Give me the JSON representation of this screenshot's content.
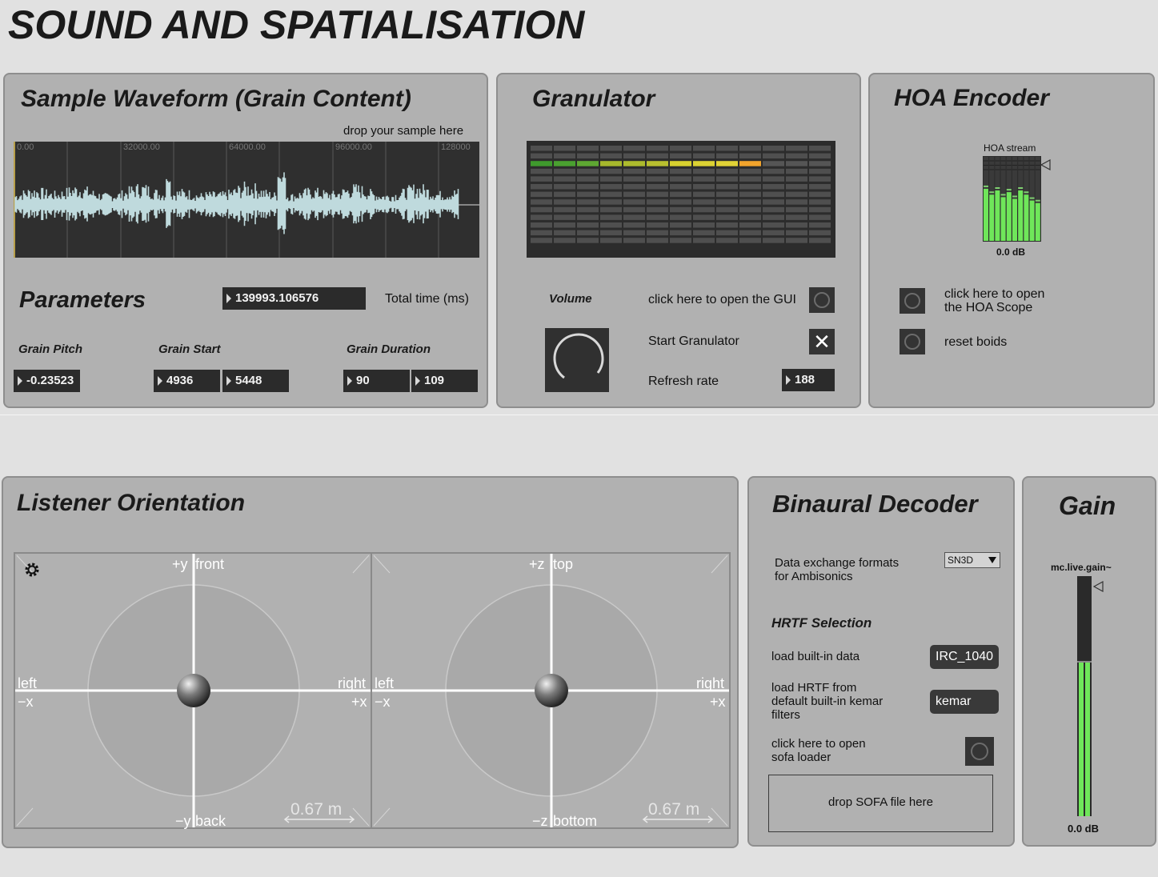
{
  "page_title": "SOUND AND SPATIALISATION",
  "waveform_panel": {
    "title": "Sample Waveform (Grain Content)",
    "drop_hint": "drop your sample here",
    "ruler": [
      "0.00",
      "32000.00",
      "64000.00",
      "96000.00",
      "128000"
    ],
    "wave_color": "#bfdadd",
    "parameters_title": "Parameters",
    "total_time_value": "139993.106576",
    "total_time_label": "Total time (ms)",
    "grain_pitch_label": "Grain Pitch",
    "grain_pitch_value": "-0.23523",
    "grain_start_label": "Grain Start",
    "grain_start_values": [
      "4936",
      "5448"
    ],
    "grain_duration_label": "Grain Duration",
    "grain_duration_values": [
      "90",
      "109"
    ]
  },
  "granulator": {
    "title": "Granulator",
    "meter_colors": [
      "#3f9a2d",
      "#4aa130",
      "#5ea832",
      "#a7b82c",
      "#adbb2d",
      "#b8bf2f",
      "#d8d12f",
      "#dcd233",
      "#e0d236",
      "#f2a42c",
      "#555555",
      "#555555",
      "#555555"
    ],
    "volume_label": "Volume",
    "volume_icon": "dial-icon",
    "open_gui_label": "click here to open the GUI",
    "start_label": "Start Granulator",
    "start_checked": "✕",
    "refresh_label": "Refresh rate",
    "refresh_value": "188"
  },
  "hoa": {
    "title": "HOA Encoder",
    "stream_label": "HOA stream",
    "meter_levels": [
      0.62,
      0.55,
      0.6,
      0.52,
      0.58,
      0.5,
      0.6,
      0.55,
      0.48,
      0.45
    ],
    "gain_db": "0.0 dB",
    "scope_label": "click here to open\nthe HOA Scope",
    "reset_label": "reset boids"
  },
  "listener": {
    "title": "Listener Orientation",
    "settings_icon": "gear-icon",
    "left_view": {
      "top_axis": "+y",
      "top_word": "front",
      "bottom_axis": "−y",
      "bottom_word": "back",
      "left_word": "left",
      "left_axis": "−x",
      "right_word": "right",
      "right_axis": "+x",
      "scale": "0.67 m"
    },
    "right_view": {
      "top_axis": "+z",
      "top_word": "top",
      "bottom_axis": "−z",
      "bottom_word": "bottom",
      "left_word": "left",
      "left_axis": "−x",
      "right_word": "right",
      "right_axis": "+x",
      "scale": "0.67 m"
    }
  },
  "binaural": {
    "title": "Binaural Decoder",
    "format_label": "Data exchange formats\nfor Ambisonics",
    "format_value": "SN3D",
    "hrtf_title": "HRTF Selection",
    "builtin_label": "load built-in data",
    "builtin_value": "IRC_1040",
    "kemar_label": "load HRTF from\ndefault built-in kemar\nfilters",
    "kemar_value": "kemar",
    "sofa_loader_label": "click here to open\nsofa loader",
    "sofa_drop_label": "drop SOFA file here"
  },
  "gain": {
    "title": "Gain",
    "object_label": "mc.live.gain~",
    "level": 0.64,
    "db_label": "0.0 dB",
    "meter_color": "#6fe65a"
  }
}
